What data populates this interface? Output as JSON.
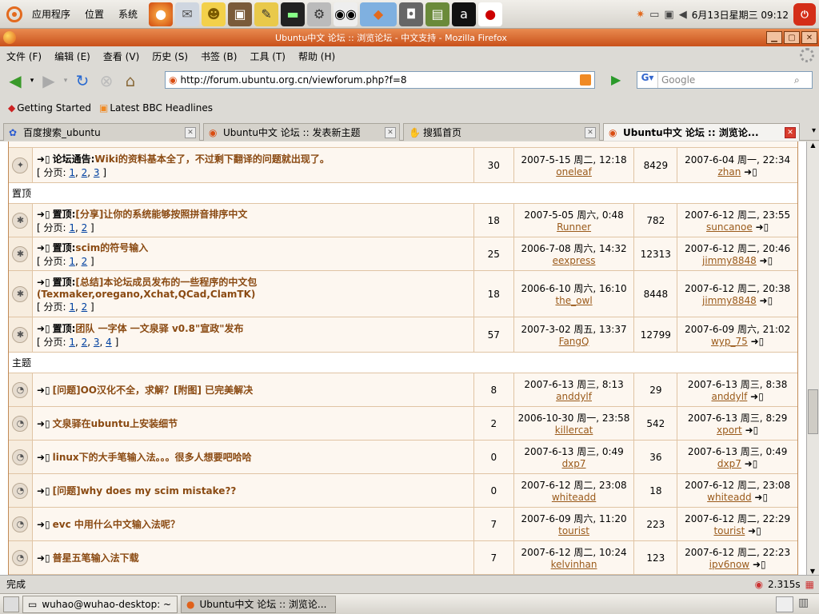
{
  "top_panel": {
    "menus": [
      "应用程序",
      "位置",
      "系统"
    ],
    "clock": "6月13日星期三 09:12"
  },
  "window": {
    "title": "Ubuntu中文 论坛 :: 浏览论坛 - 中文支持 - Mozilla Firefox"
  },
  "menubar": [
    "文件 (F)",
    "编辑 (E)",
    "查看 (V)",
    "历史 (S)",
    "书签 (B)",
    "工具 (T)",
    "帮助 (H)"
  ],
  "url": "http://forum.ubuntu.org.cn/viewforum.php?f=8",
  "search_placeholder": "Google",
  "bookmarks": [
    "Getting Started",
    "Latest BBC Headlines"
  ],
  "tabs": [
    "百度搜索_ubuntu",
    "Ubuntu中文 论坛 :: 发表新主题",
    "搜狐首页",
    "Ubuntu中文 论坛 :: 浏览论..."
  ],
  "sections": {
    "sticky": "置顶",
    "topics": "主题"
  },
  "pages_label": "分页:",
  "rows": [
    {
      "prefix": "论坛通告:",
      "title": "Wiki的资料基本全了，不过剩下翻译的问题就出现了。",
      "pages": [
        "1",
        "2",
        "3"
      ],
      "replies": "30",
      "post_date": "2007-5-15 周二, 12:18",
      "poster": "oneleaf",
      "views": "8429",
      "last_date": "2007-6-04 周一, 22:34",
      "last_user": "zhan"
    },
    {
      "prefix": "置顶:",
      "title": "[分享]让你的系统能够按照拼音排序中文",
      "pages": [
        "1",
        "2"
      ],
      "replies": "18",
      "post_date": "2007-5-05 周六, 0:48",
      "poster": "Runner",
      "views": "782",
      "last_date": "2007-6-12 周二, 23:55",
      "last_user": "suncanoe"
    },
    {
      "prefix": "置顶:",
      "title": "scim的符号输入",
      "pages": [
        "1",
        "2"
      ],
      "replies": "25",
      "post_date": "2006-7-08 周六, 14:32",
      "poster": "eexpress",
      "views": "12313",
      "last_date": "2007-6-12 周二, 20:46",
      "last_user": "jimmy8848"
    },
    {
      "prefix": "置顶:",
      "title": "[总结]本论坛成员发布的一些程序的中文包(Texmaker,oregano,Xchat,QCad,ClamTK)",
      "pages": [
        "1",
        "2"
      ],
      "replies": "18",
      "post_date": "2006-6-10 周六, 16:10",
      "poster": "the_owl",
      "views": "8448",
      "last_date": "2007-6-12 周二, 20:38",
      "last_user": "jimmy8848"
    },
    {
      "prefix": "置顶:",
      "title": "团队 一字体 一文泉驿 v0.8\"宣政\"发布",
      "pages": [
        "1",
        "2",
        "3",
        "4"
      ],
      "replies": "57",
      "post_date": "2007-3-02 周五, 13:37",
      "poster": "FangQ",
      "views": "12799",
      "last_date": "2007-6-09 周六, 21:02",
      "last_user": "wyp_75"
    },
    {
      "prefix": "",
      "title": "[问题]OO汉化不全，求解？[附图] 已完美解决",
      "pages": [],
      "replies": "8",
      "post_date": "2007-6-13 周三, 8:13",
      "poster": "anddylf",
      "views": "29",
      "last_date": "2007-6-13 周三, 8:38",
      "last_user": "anddylf"
    },
    {
      "prefix": "",
      "title": "文泉驿在ubuntu上安装细节",
      "pages": [],
      "replies": "2",
      "post_date": "2006-10-30 周一, 23:58",
      "poster": "killercat",
      "views": "542",
      "last_date": "2007-6-13 周三, 8:29",
      "last_user": "xport"
    },
    {
      "prefix": "",
      "title": "linux下的大手笔输入法。。。很多人想要吧哈哈",
      "pages": [],
      "replies": "0",
      "post_date": "2007-6-13 周三, 0:49",
      "poster": "dxp7",
      "views": "36",
      "last_date": "2007-6-13 周三, 0:49",
      "last_user": "dxp7"
    },
    {
      "prefix": "",
      "title": "[问题]why does my scim mistake??",
      "pages": [],
      "replies": "0",
      "post_date": "2007-6-12 周二, 23:08",
      "poster": "whiteadd",
      "views": "18",
      "last_date": "2007-6-12 周二, 23:08",
      "last_user": "whiteadd"
    },
    {
      "prefix": "",
      "title": "evc 中用什么中文输入法呢？",
      "pages": [],
      "replies": "7",
      "post_date": "2007-6-09 周六, 11:20",
      "poster": "tourist",
      "views": "223",
      "last_date": "2007-6-12 周二, 22:29",
      "last_user": "tourist"
    },
    {
      "prefix": "",
      "title": "普星五笔输入法下载",
      "pages": [],
      "replies": "7",
      "post_date": "2007-6-12 周二, 10:24",
      "poster": "kelvinhan",
      "views": "123",
      "last_date": "2007-6-12 周二, 22:23",
      "last_user": "ipv6now"
    }
  ],
  "status": {
    "text": "完成",
    "time": "2.315s"
  },
  "taskbar": [
    "wuhao@wuhao-desktop: ~",
    "Ubuntu中文 论坛 :: 浏览论..."
  ]
}
